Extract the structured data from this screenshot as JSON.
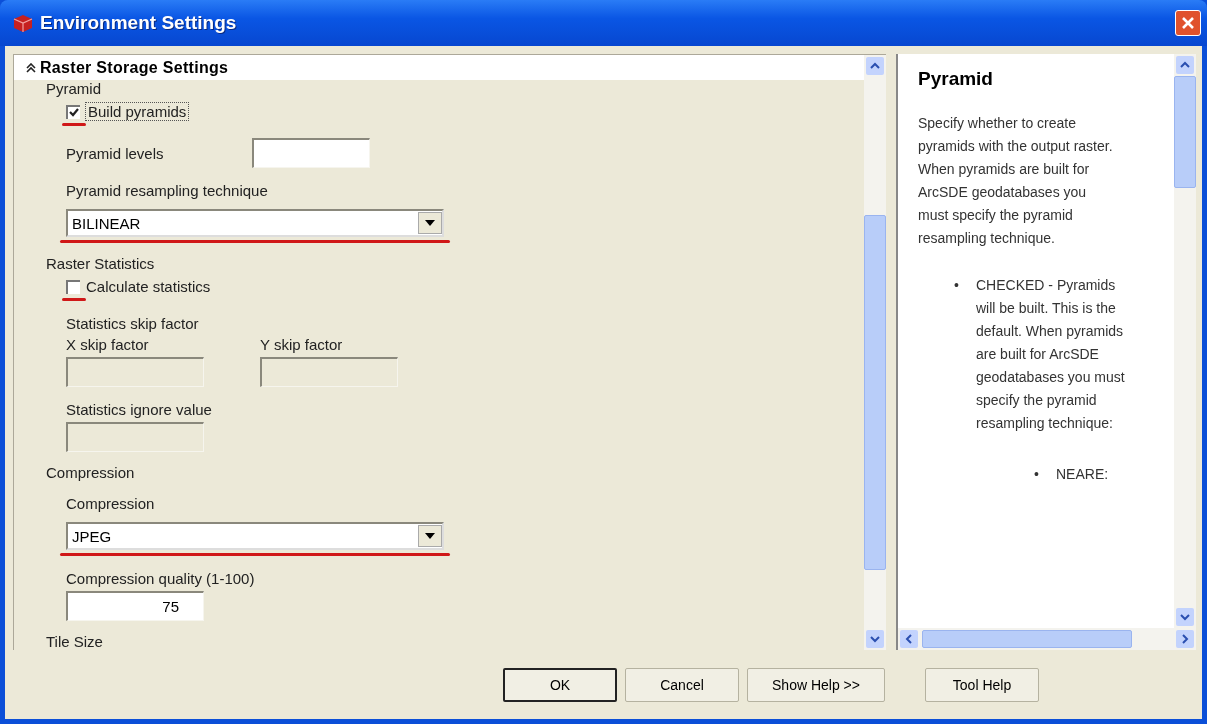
{
  "window": {
    "title": "Environment Settings"
  },
  "section": {
    "title": "Raster Storage Settings",
    "expanded": true
  },
  "items": [
    {
      "kind": "group",
      "label": "Pyramid"
    },
    {
      "kind": "checkbox",
      "label": "Build pyramids",
      "checked": true,
      "focused": true,
      "underlined": true
    },
    {
      "kind": "inline_field",
      "label": "Pyramid levels",
      "disabled": false
    },
    {
      "kind": "label",
      "label": "Pyramid resampling technique"
    },
    {
      "kind": "dropdown",
      "value": "BILINEAR",
      "underlined": true
    },
    {
      "kind": "group",
      "label": "Raster Statistics"
    },
    {
      "kind": "checkbox",
      "label": "Calculate statistics",
      "checked": false,
      "focused": false,
      "underlined": true
    },
    {
      "kind": "label",
      "label": "Statistics skip factor"
    },
    {
      "kind": "field_pair",
      "fields": [
        {
          "label": "X skip factor",
          "disabled": true
        },
        {
          "label": "Y skip factor",
          "disabled": true
        }
      ]
    },
    {
      "kind": "field",
      "label": "Statistics ignore value",
      "disabled": true
    },
    {
      "kind": "group",
      "label": "Compression"
    },
    {
      "kind": "label",
      "label": "Compression"
    },
    {
      "kind": "dropdown",
      "value": "JPEG",
      "underlined": true
    },
    {
      "kind": "field",
      "label": "Compression quality (1-100)",
      "value": "75",
      "disabled": false
    },
    {
      "kind": "group",
      "label": "Tile Size"
    }
  ],
  "help": {
    "title": "Pyramid",
    "paragraph": "Specify whether to create pyramids with the output raster. When pyramids are built for ArcSDE geodatabases you must specify the pyramid resampling technique.",
    "bullets": [
      {
        "marker": "•",
        "text": "CHECKED - Pyramids will be built. This is the default. When pyramids are built for ArcSDE geodatabases you must specify the pyramid resampling technique:",
        "children": [
          {
            "marker": "•",
            "text": "NEARE:"
          }
        ]
      }
    ]
  },
  "buttons": [
    {
      "label": "OK",
      "default": true
    },
    {
      "label": "Cancel",
      "default": false
    },
    {
      "label": "Show Help >>",
      "default": false
    },
    {
      "label": "Tool Help",
      "default": false
    }
  ]
}
